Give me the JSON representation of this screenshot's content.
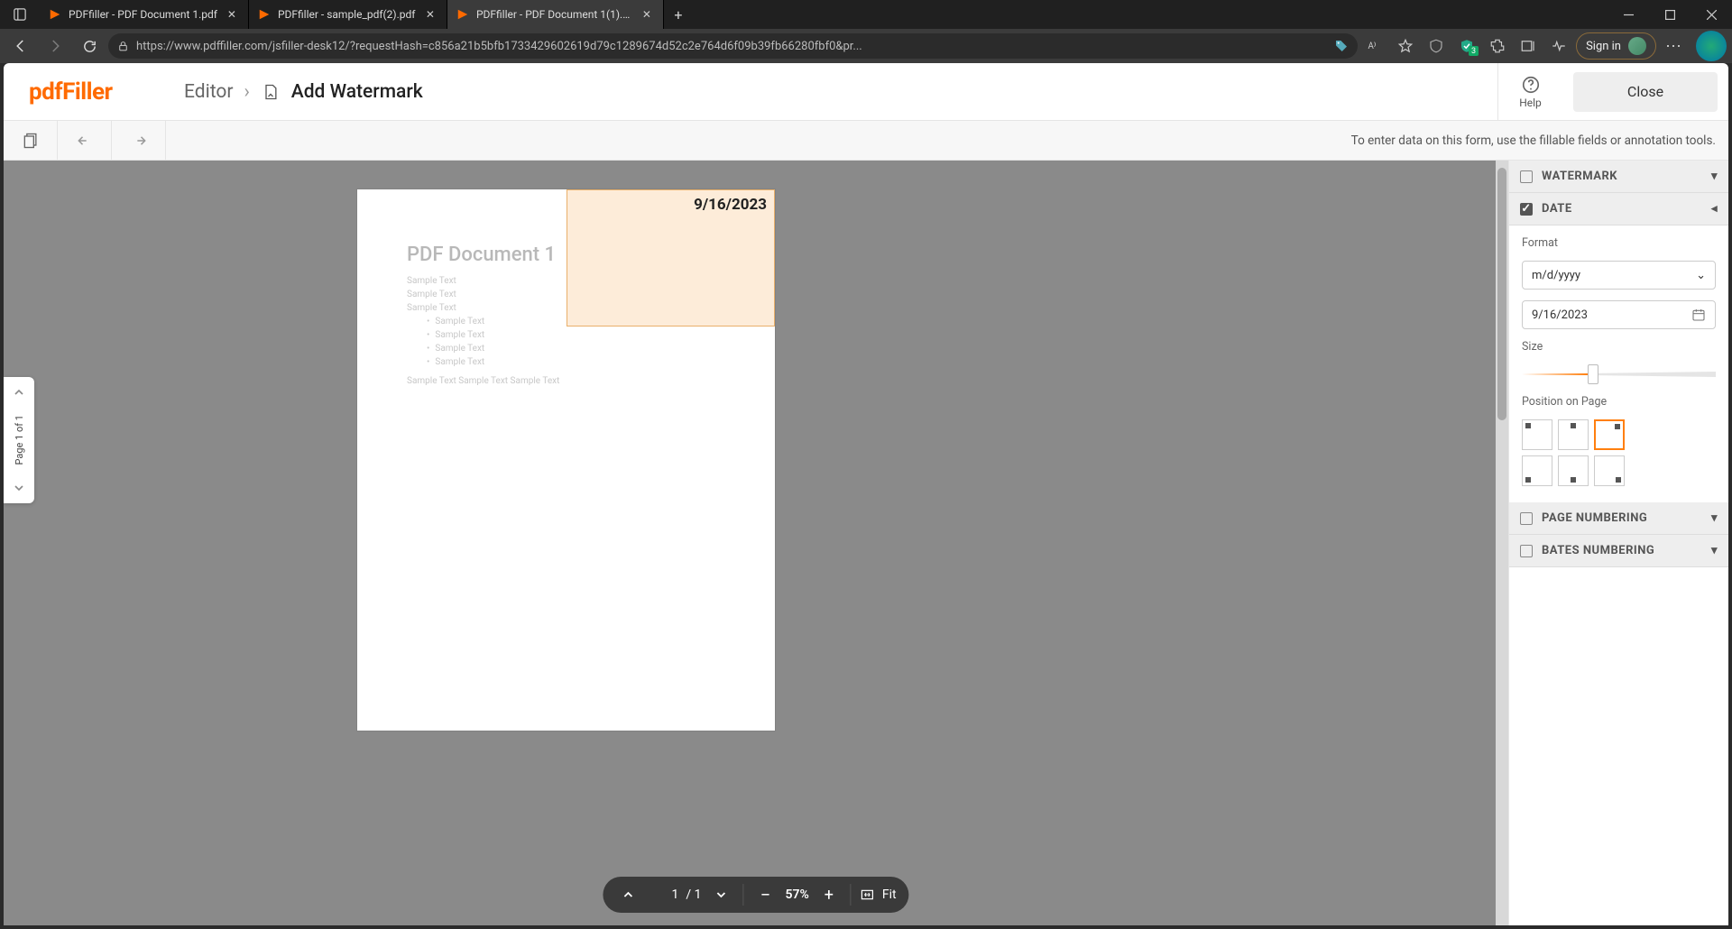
{
  "browser": {
    "tabs": [
      {
        "label": "PDFfiller - PDF Document 1.pdf",
        "active": false
      },
      {
        "label": "PDFfiller - sample_pdf(2).pdf",
        "active": false
      },
      {
        "label": "PDFfiller - PDF Document 1(1).pd",
        "active": true
      }
    ],
    "url": "https://www.pdffiller.com/jsfiller-desk12/?requestHash=c856a21b5bfb1733429602619d79c1289674d52c2e764d6f09b39fb66280fbf0&pr...",
    "signin": "Sign in",
    "shield_badge": "3"
  },
  "app": {
    "logo": "pdfFiller",
    "breadcrumb": {
      "editor": "Editor",
      "current": "Add Watermark"
    },
    "help_label": "Help",
    "close_label": "Close",
    "hint": "To enter data on this form, use the fillable fields or annotation tools."
  },
  "page_nav": {
    "label": "Page 1 of 1"
  },
  "document": {
    "title": "PDF Document 1",
    "lines": [
      "Sample Text",
      "Sample Text",
      "Sample Text"
    ],
    "bullets": [
      "Sample Text",
      "Sample Text",
      "Sample Text",
      "Sample Text"
    ],
    "footer": "Sample Text Sample Text Sample Text",
    "date_overlay_text": "9/16/2023"
  },
  "zoom": {
    "page": "1",
    "total": "/ 1",
    "percent": "57%",
    "fit": "Fit"
  },
  "panel": {
    "sections": {
      "watermark": "WATERMARK",
      "date": "DATE",
      "page_numbering": "PAGE NUMBERING",
      "bates": "BATES NUMBERING"
    },
    "date": {
      "format_label": "Format",
      "format_value": "m/d/yyyy",
      "date_value": "9/16/2023",
      "size_label": "Size",
      "position_label": "Position on Page"
    }
  }
}
